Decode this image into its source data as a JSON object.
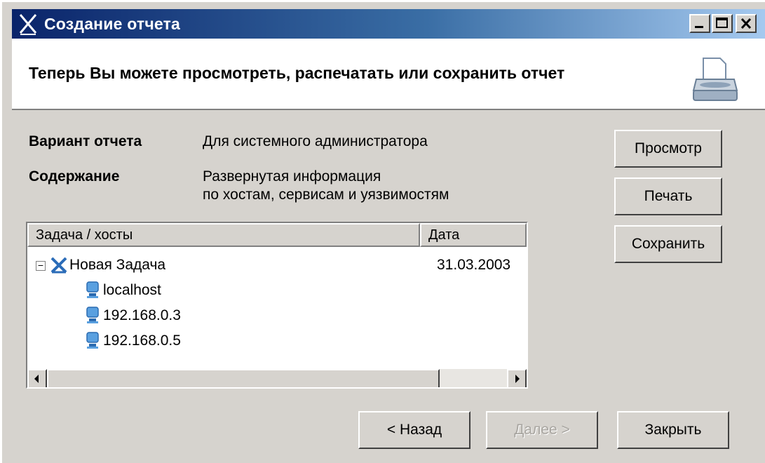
{
  "window": {
    "title": "Создание отчета",
    "icon": "x-logo-icon",
    "controls": [
      "minimize-icon",
      "maximize-icon",
      "close-icon"
    ]
  },
  "header": {
    "text": "Теперь Вы можете просмотреть, распечатать или сохранить отчет",
    "icon": "printer-icon"
  },
  "info": {
    "variant_label": "Вариант отчета",
    "variant_value": "Для системного администратора",
    "content_label": "Содержание",
    "content_value_line1": "Развернутая информация",
    "content_value_line2": "по хостам, сервисам и уязвимостям"
  },
  "actions": {
    "preview": "Просмотр",
    "print": "Печать",
    "save": "Сохранить"
  },
  "tree": {
    "columns": [
      "Задача / хосты",
      "Дата"
    ],
    "task": {
      "name": "Новая Задача",
      "date": "31.03.2003",
      "expander": "−"
    },
    "hosts": [
      "localhost",
      "192.168.0.3",
      "192.168.0.5"
    ]
  },
  "nav": {
    "back": "< Назад",
    "next": "Далее >",
    "close": "Закрыть"
  },
  "colors": {
    "title_start": "#0a246a",
    "title_end": "#a6caf0",
    "face": "#d6d3ce"
  }
}
